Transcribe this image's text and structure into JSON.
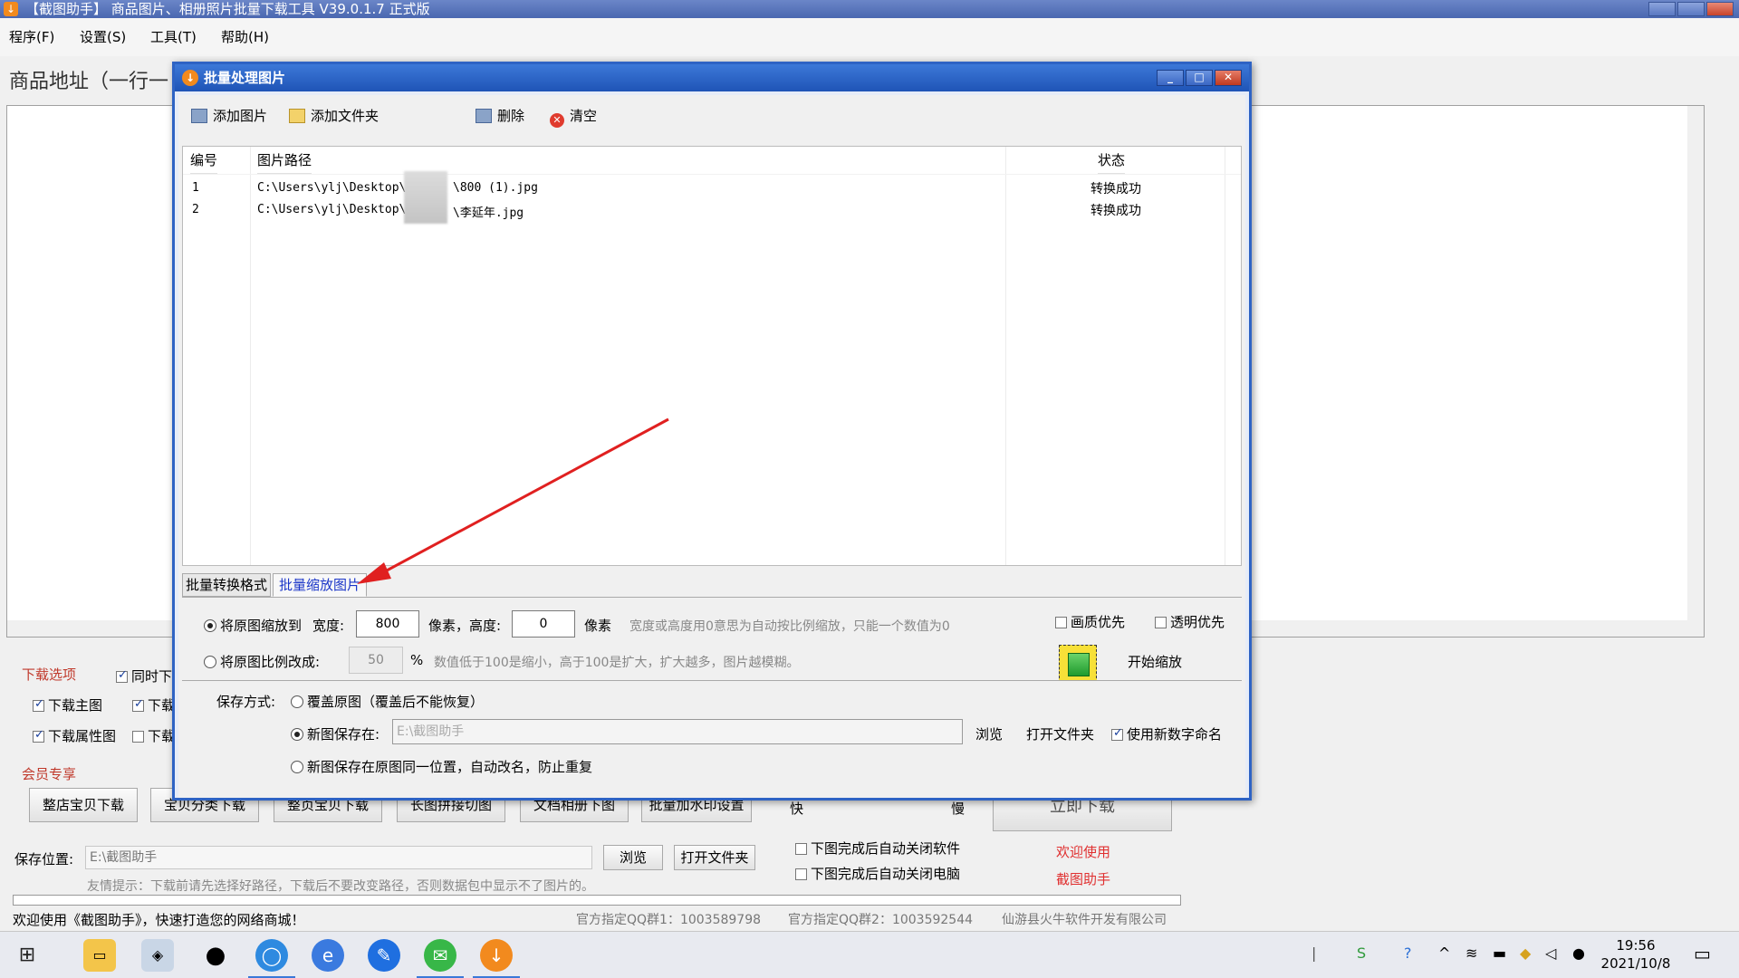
{
  "main": {
    "title": "【截图助手】 商品图片、相册照片批量下载工具 V39.0.1.7 正式版",
    "menus": [
      "程序(F)",
      "设置(S)",
      "工具(T)",
      "帮助(H)"
    ],
    "url_label": "商品地址（一行一",
    "download_options_label": "下载选项",
    "checkboxes": [
      {
        "label": "同时下",
        "checked": true
      },
      {
        "label": "下载主图",
        "checked": true
      },
      {
        "label": "下载",
        "checked": true
      },
      {
        "label": "下载属性图",
        "checked": true
      },
      {
        "label": "下载",
        "checked": false
      }
    ],
    "member_label": "会员专享",
    "member_buttons": [
      "整店宝贝下载",
      "宝贝分类下载",
      "整页宝贝下载",
      "长图拼接切图",
      "文档相册下图",
      "批量加水印设置"
    ],
    "speed_fast": "快",
    "speed_slow": "慢",
    "auto_close_software": {
      "label": "下图完成后自动关闭软件",
      "checked": false
    },
    "auto_shutdown": {
      "label": "下图完成后自动关闭电脑",
      "checked": false
    },
    "download_now": "立即下载",
    "welcome_red": [
      "欢迎使用",
      "截图助手"
    ],
    "save_label": "保存位置:",
    "save_path": "E:\\截图助手",
    "browse": "浏览",
    "open_folder": "打开文件夹",
    "tip": "友情提示：下载前请先选择好路径，下载后不要改变路径，否则数据包中显示不了图片的。",
    "status_welcome": "欢迎使用《截图助手》，快速打造您的网络商城！",
    "qq1": "官方指定QQ群1：1003589798",
    "qq2": "官方指定QQ群2：1003592544",
    "company": "仙游县火牛软件开发有限公司"
  },
  "dialog": {
    "title": "批量处理图片",
    "toolbar": {
      "add_image": "添加图片",
      "add_folder": "添加文件夹",
      "delete": "删除",
      "clear": "清空"
    },
    "table": {
      "headers": [
        "编号",
        "图片路径",
        "状态"
      ],
      "rows": [
        {
          "num": "1",
          "path_a": "C:\\Users\\ylj\\Desktop\\",
          "path_b": "\\800 (1).jpg",
          "status": "转换成功"
        },
        {
          "num": "2",
          "path_a": "C:\\Users\\ylj\\Desktop\\",
          "path_b": "\\李延年.jpg",
          "status": "转换成功"
        }
      ]
    },
    "tabs": [
      "批量转换格式",
      "批量缩放图片"
    ],
    "resize": {
      "option1_label": "将原图缩放到",
      "width_label": "宽度:",
      "width_value": "800",
      "px1": "像素，高度:",
      "height_value": "0",
      "px2": "像素",
      "hint1": "宽度或高度用0意思为自动按比例缩放，只能一个数值为0",
      "option2_label": "将原图比例改成:",
      "percent_value": "50",
      "percent_sign": "%",
      "hint2": "数值低于100是缩小，高于100是扩大，扩大越多，图片越模糊。",
      "quality_first": {
        "label": "画质优先",
        "checked": false
      },
      "transparent_first": {
        "label": "透明优先",
        "checked": false
      },
      "start_label": "开始缩放"
    },
    "save": {
      "mode_label": "保存方式:",
      "overwrite": "覆盖原图（覆盖后不能恢复）",
      "save_new": "新图保存在:",
      "save_path": "E:\\截图助手",
      "browse": "浏览",
      "open_folder": "打开文件夹",
      "numeric_name": {
        "label": "使用新数字命名",
        "checked": true
      },
      "same_location": "新图保存在原图同一位置，自动改名，防止重复"
    }
  },
  "taskbar": {
    "time": "19:56",
    "date": "2021/10/8"
  },
  "colors": {
    "dialog_title": "#1f54b6",
    "accent_red": "#e03030",
    "arrow": "#e02020",
    "tab_active_text": "#1a35c8"
  }
}
